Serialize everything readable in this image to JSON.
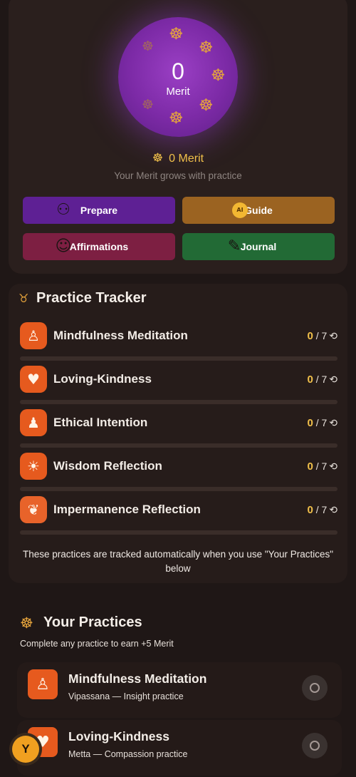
{
  "merit": {
    "value": "0",
    "label": "Merit",
    "summary": "0 Merit",
    "subtitle": "Your Merit grows with practice"
  },
  "actions": {
    "prepare": "Prepare",
    "guide": "Guide",
    "guide_badge": "AI",
    "affirmations": "Affirmations",
    "journal": "Journal"
  },
  "tracker": {
    "title": "Practice Tracker",
    "items": [
      {
        "name": "Mindfulness Meditation",
        "done": "0",
        "total": "/ 7",
        "progress": 0,
        "icon": "meditation-icon"
      },
      {
        "name": "Loving-Kindness",
        "done": "0",
        "total": "/ 7",
        "progress": 0,
        "icon": "heart-hands-icon"
      },
      {
        "name": "Ethical Intention",
        "done": "0",
        "total": "/ 7",
        "progress": 0,
        "icon": "person-icon"
      },
      {
        "name": "Wisdom Reflection",
        "done": "0",
        "total": "/ 7",
        "progress": 0,
        "icon": "head-lightbulb-icon"
      },
      {
        "name": "Impermanence Reflection",
        "done": "0",
        "total": "/ 7",
        "progress": 0,
        "icon": "leaf-icon"
      }
    ],
    "note": "These practices are tracked automatically when you use \"Your Practices\" below"
  },
  "your_practices": {
    "title": "Your Practices",
    "subtitle": "Complete any practice to earn +5 Merit",
    "items": [
      {
        "name": "Mindfulness Meditation",
        "subtitle": "Vipassana — Insight practice",
        "icon": "meditation-icon"
      },
      {
        "name": "Loving-Kindness",
        "subtitle": "Metta — Compassion practice",
        "icon": "heart-hands-icon"
      }
    ]
  },
  "user": {
    "avatar_initial": "Y"
  },
  "colors": {
    "background": "#1f1716",
    "accent_gold": "#f1c04a",
    "orb_purple": "#7c2aa6",
    "icon_orange": "#e65a1e",
    "prepare": "#5e2094",
    "guide": "#9b6321",
    "affirmations": "#7d1f42",
    "journal": "#226a35"
  }
}
